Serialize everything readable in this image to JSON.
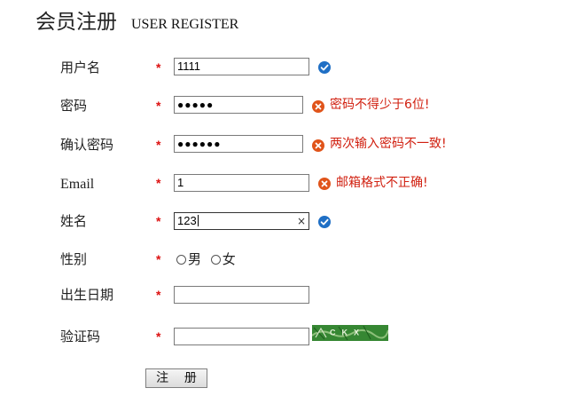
{
  "header": {
    "title": "会员注册",
    "subtitle": "USER REGISTER"
  },
  "form": {
    "username": {
      "label": "用户名",
      "required": "*",
      "value": "1111",
      "status": "valid"
    },
    "password": {
      "label": "密码",
      "required": "*",
      "value_masked": "●●●●●",
      "status": "error",
      "error": "密码不得少于6位!"
    },
    "confirm_password": {
      "label": "确认密码",
      "required": "*",
      "value_masked": "●●●●●●",
      "status": "error",
      "error": "两次输入密码不一致!"
    },
    "email": {
      "label": "Email",
      "required": "*",
      "value": "1",
      "status": "error",
      "error": "邮箱格式不正确!"
    },
    "name": {
      "label": "姓名",
      "required": "*",
      "value": "123",
      "clear_glyph": "×",
      "status": "valid"
    },
    "gender": {
      "label": "性别",
      "required": "*",
      "options": [
        "男",
        "女"
      ],
      "selected": null
    },
    "birthdate": {
      "label": "出生日期",
      "required": "*",
      "value": ""
    },
    "captcha": {
      "label": "验证码",
      "required": "*",
      "value": "",
      "image_text": "CKX"
    },
    "submit_label": "注    册"
  },
  "icons": {
    "valid": "check-circle-icon",
    "error": "error-circle-icon"
  },
  "colors": {
    "required_star": "#dd1111",
    "error_text": "#d12010",
    "valid_icon": "#1f6fc5",
    "error_icon": "#e0541a"
  }
}
